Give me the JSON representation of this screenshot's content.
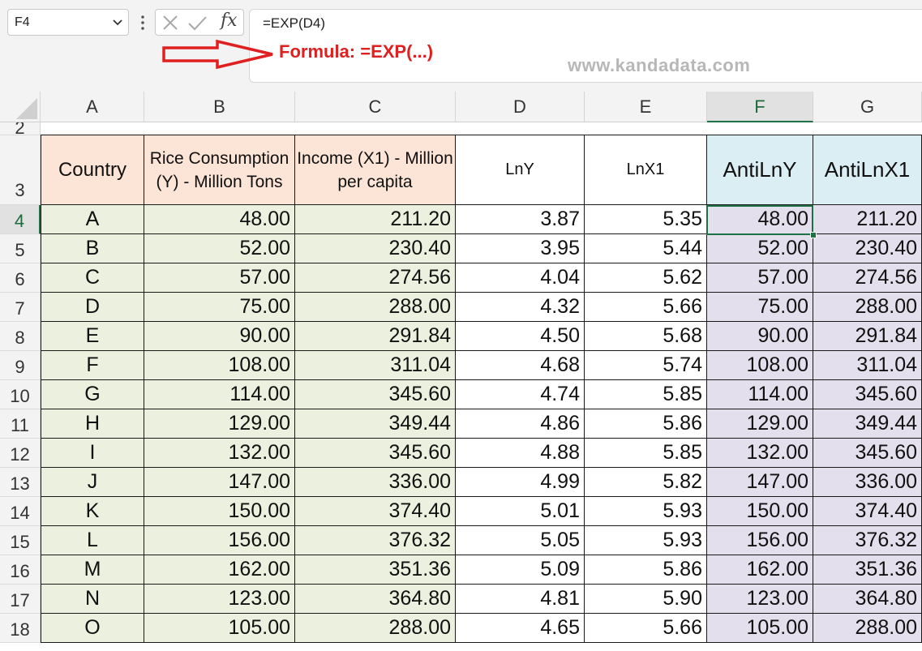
{
  "name_box": {
    "value": "F4"
  },
  "formula_bar": {
    "text": "=EXP(D4)"
  },
  "annotation": {
    "text": "Formula: =EXP(...)"
  },
  "watermark": {
    "text": "www.kandadata.com"
  },
  "columns": [
    "A",
    "B",
    "C",
    "D",
    "E",
    "F",
    "G"
  ],
  "row_numbers": [
    "2",
    "3",
    "4",
    "5",
    "6",
    "7",
    "8",
    "9",
    "10",
    "11",
    "12",
    "13",
    "14",
    "15",
    "16",
    "17",
    "18"
  ],
  "headers": {
    "country": "Country",
    "rice": "Rice Consumption (Y) - Million Tons",
    "income": "Income (X1) - Million per capita",
    "lny": "LnY",
    "lnx1": "LnX1",
    "antilny": "AntiLnY",
    "antilnx1": "AntiLnX1"
  },
  "rows": [
    [
      "A",
      "48.00",
      "211.20",
      "3.87",
      "5.35",
      "48.00",
      "211.20"
    ],
    [
      "B",
      "52.00",
      "230.40",
      "3.95",
      "5.44",
      "52.00",
      "230.40"
    ],
    [
      "C",
      "57.00",
      "274.56",
      "4.04",
      "5.62",
      "57.00",
      "274.56"
    ],
    [
      "D",
      "75.00",
      "288.00",
      "4.32",
      "5.66",
      "75.00",
      "288.00"
    ],
    [
      "E",
      "90.00",
      "291.84",
      "4.50",
      "5.68",
      "90.00",
      "291.84"
    ],
    [
      "F",
      "108.00",
      "311.04",
      "4.68",
      "5.74",
      "108.00",
      "311.04"
    ],
    [
      "G",
      "114.00",
      "345.60",
      "4.74",
      "5.85",
      "114.00",
      "345.60"
    ],
    [
      "H",
      "129.00",
      "349.44",
      "4.86",
      "5.86",
      "129.00",
      "349.44"
    ],
    [
      "I",
      "132.00",
      "345.60",
      "4.88",
      "5.85",
      "132.00",
      "345.60"
    ],
    [
      "J",
      "147.00",
      "336.00",
      "4.99",
      "5.82",
      "147.00",
      "336.00"
    ],
    [
      "K",
      "150.00",
      "374.40",
      "5.01",
      "5.93",
      "150.00",
      "374.40"
    ],
    [
      "L",
      "156.00",
      "376.32",
      "5.05",
      "5.93",
      "156.00",
      "376.32"
    ],
    [
      "M",
      "162.00",
      "351.36",
      "5.09",
      "5.86",
      "162.00",
      "351.36"
    ],
    [
      "N",
      "123.00",
      "364.80",
      "4.81",
      "5.90",
      "123.00",
      "364.80"
    ],
    [
      "O",
      "105.00",
      "288.00",
      "4.65",
      "5.66",
      "105.00",
      "288.00"
    ]
  ]
}
